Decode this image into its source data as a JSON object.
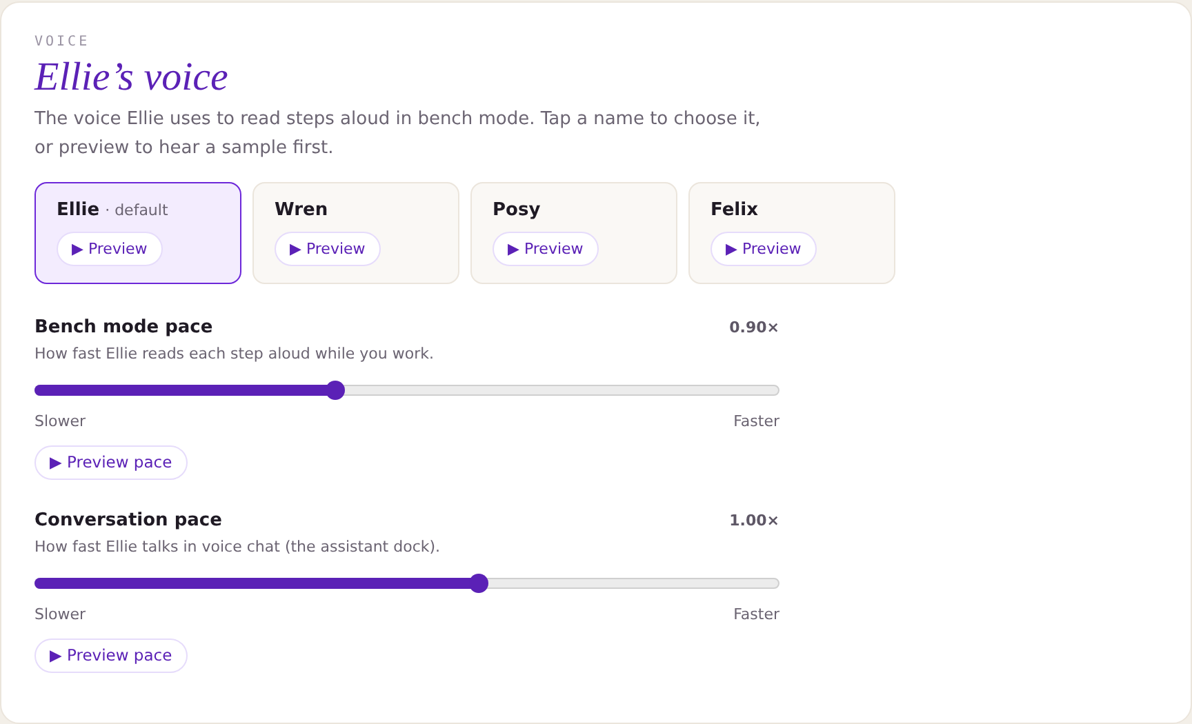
{
  "eyebrow": "VOICE",
  "title": "Ellie’s voice",
  "description": "The voice Ellie uses to read steps aloud in bench mode. Tap a name to choose it, or preview to hear a sample first.",
  "voices": [
    {
      "name": "Ellie",
      "note": "· default",
      "selected": true,
      "preview": "▶ Preview"
    },
    {
      "name": "Wren",
      "selected": false,
      "preview": "▶ Preview"
    },
    {
      "name": "Posy",
      "selected": false,
      "preview": "▶ Preview"
    },
    {
      "name": "Felix",
      "selected": false,
      "preview": "▶ Preview"
    }
  ],
  "paces": [
    {
      "label": "Bench mode pace",
      "reading": "0.90×",
      "hint": "How fast Ellie reads each step aloud while you work.",
      "level": 0.404,
      "min_label": "Slower",
      "max_label": "Faster",
      "button": "▶ Preview pace"
    },
    {
      "label": "Conversation pace",
      "reading": "1.00×",
      "hint": "How fast Ellie talks in voice chat (the assistant dock).",
      "level": 0.596,
      "min_label": "Slower",
      "max_label": "Faster",
      "button": "▶ Preview pace"
    }
  ]
}
